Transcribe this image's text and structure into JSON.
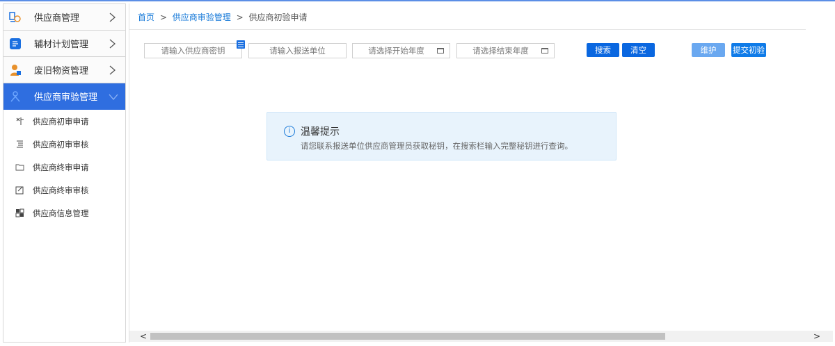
{
  "sidebar": {
    "items": [
      {
        "label": "供应商管理",
        "icon": "supplier-icon",
        "active": false
      },
      {
        "label": "辅材计划管理",
        "icon": "plan-icon",
        "active": false
      },
      {
        "label": "废旧物资管理",
        "icon": "waste-icon",
        "active": false
      },
      {
        "label": "供应商审验管理",
        "icon": "review-icon",
        "active": true
      }
    ],
    "subitems": [
      {
        "label": "供应商初审申请",
        "icon": "apply-icon"
      },
      {
        "label": "供应商初审审核",
        "icon": "list-icon"
      },
      {
        "label": "供应商终审申请",
        "icon": "folder-icon"
      },
      {
        "label": "供应商终审审核",
        "icon": "edit-icon"
      },
      {
        "label": "供应商信息管理",
        "icon": "info-icon"
      }
    ]
  },
  "breadcrumb": {
    "home": "首页",
    "section": "供应商审验管理",
    "current": "供应商初验申请",
    "sep1": ">",
    "sep2": ">"
  },
  "search": {
    "key_placeholder": "请输入供应商密钥",
    "unit_placeholder": "请输入报送单位",
    "start_year_placeholder": "请选择开始年度",
    "end_year_placeholder": "请选择结束年度",
    "search_label": "搜索",
    "clear_label": "清空",
    "maintain_label": "维护",
    "submit_label": "提交初验"
  },
  "notice": {
    "icon_text": "i",
    "title": "温馨提示",
    "text": "请您联系报送单位供应商管理员获取秘钥，在搜索栏输入完整秘钥进行查询。"
  },
  "scrollbar": {
    "left": "<",
    "right": ">"
  },
  "colors": {
    "accent": "#2f6ee0",
    "link": "#1478d8",
    "notice_bg": "#e8f3fc"
  }
}
